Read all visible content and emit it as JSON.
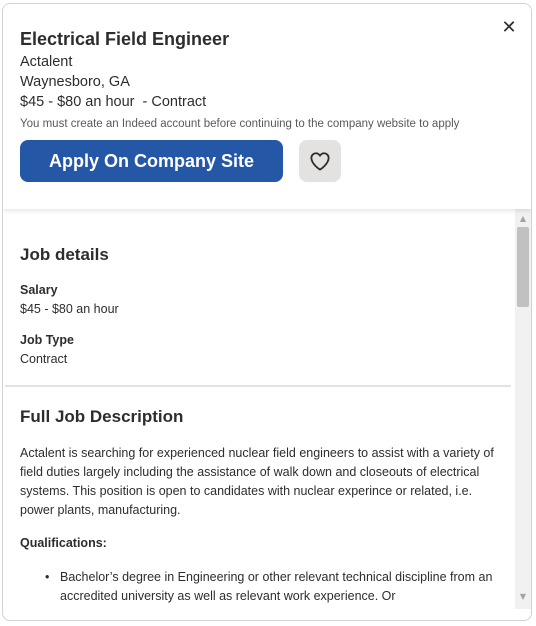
{
  "header": {
    "close_icon": "close-icon",
    "job_title": "Electrical Field Engineer",
    "company": "Actalent",
    "location": "Waynesboro, GA",
    "salary_type": "$45 - $80 an hour  - Contract",
    "notice": "You must create an Indeed account before continuing to the company website to apply",
    "apply_label": "Apply On Company Site",
    "save_icon": "heart-icon",
    "accent_color": "#2557a7"
  },
  "job_details": {
    "title": "Job details",
    "salary_label": "Salary",
    "salary_value": "$45 - $80 an hour",
    "type_label": "Job Type",
    "type_value": "Contract"
  },
  "description": {
    "title": "Full Job Description",
    "body": "Actalent is searching for experienced nuclear field engineers to assist with a variety of field duties largely including the assistance of walk down and closeouts of electrical systems. This position is open to candidates with nuclear experince or related, i.e. power plants, manufacturing.",
    "qualifications_label": "Qualifications:",
    "qualifications": [
      "Bachelor’s degree in Engineering or other relevant technical discipline from an accredited university as well as relevant work experience. Or"
    ]
  },
  "scrollbar": {
    "up_icon": "scroll-up-arrow-icon",
    "down_icon": "scroll-down-arrow-icon"
  }
}
